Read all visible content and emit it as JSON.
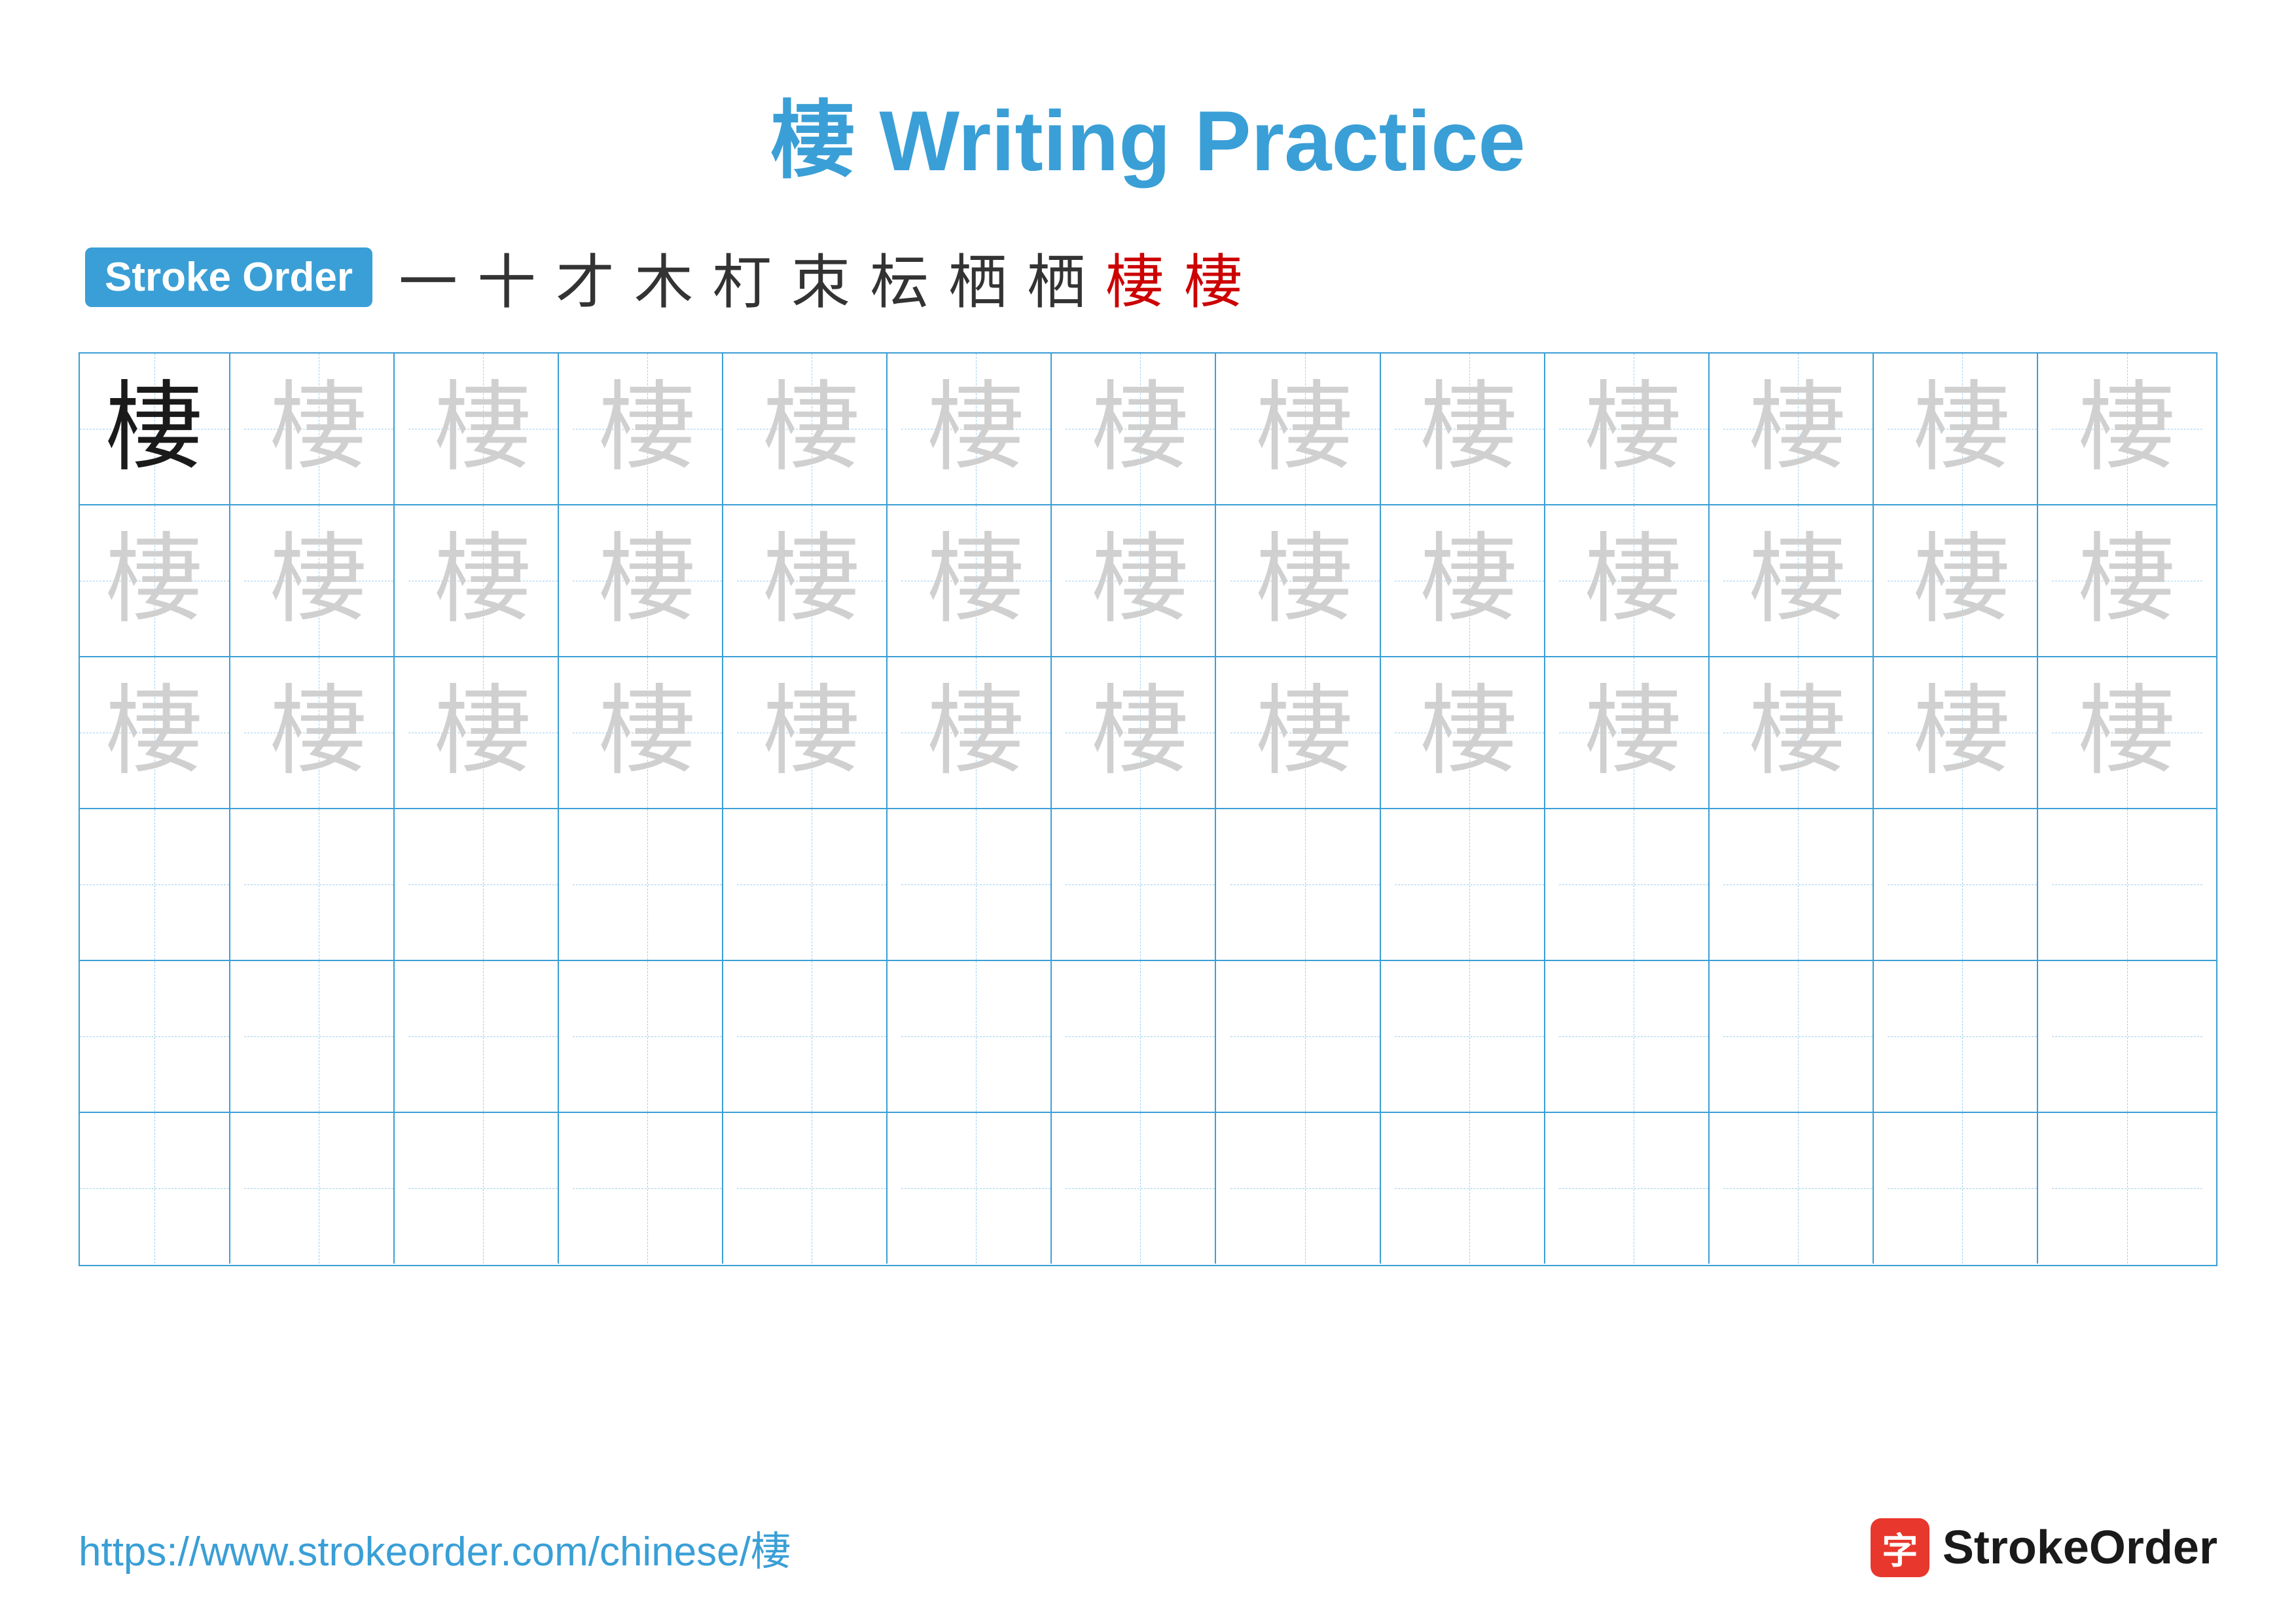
{
  "title": {
    "char": "棲",
    "label": "Writing Practice",
    "full": "棲 Writing Practice"
  },
  "stroke_order": {
    "badge_label": "Stroke Order",
    "strokes": [
      "一",
      "十",
      "才",
      "木",
      "朾",
      "朿",
      "枟",
      "栖",
      "栖",
      "棲",
      "棲"
    ]
  },
  "grid": {
    "rows": 6,
    "cols": 13,
    "character": "棲",
    "row_types": [
      "solid_then_light",
      "all_light",
      "all_light",
      "empty",
      "empty",
      "empty"
    ]
  },
  "footer": {
    "url": "https://www.strokeorder.com/chinese/棲",
    "brand_char": "字",
    "brand_name": "StrokeOrder"
  }
}
